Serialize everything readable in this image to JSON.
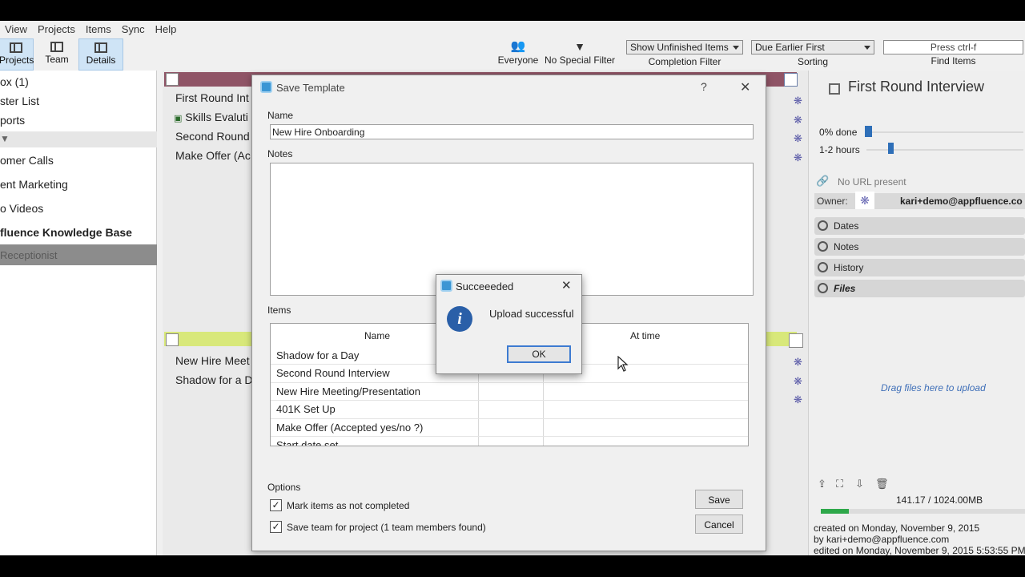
{
  "menu": [
    "View",
    "Projects",
    "Items",
    "Sync",
    "Help"
  ],
  "toolbar": {
    "projects": "Projects",
    "team": "Team",
    "details": "Details",
    "everyone": "Everyone",
    "no_special_filter": "No Special Filter",
    "completion_value": "Show Unfinished Items",
    "completion_label": "Completion Filter",
    "sorting_value": "Due Earlier First",
    "sorting_label": "Sorting",
    "find_placeholder": "Press ctrl-f",
    "find_label": "Find Items"
  },
  "leftnav": {
    "items": [
      "ox (1)",
      "ster List",
      "ports",
      "omer Calls",
      "ent Marketing",
      "o Videos",
      "fluence Knowledge Base",
      "Receptionist"
    ]
  },
  "center": {
    "items_top": [
      "First Round Int",
      "Skills Evaluti",
      "Second Round",
      "Make Offer (Ac"
    ],
    "items_bottom": [
      "New Hire Meet",
      "Shadow for a D"
    ]
  },
  "right": {
    "title": "First Round Interview",
    "done": "0% done",
    "hours": "1-2 hours",
    "progress_pct": 0,
    "url": "No URL present",
    "owner_label": "Owner:",
    "owner_value": "kari+demo@appfluence.co",
    "sections": [
      "Dates",
      "Notes",
      "History",
      "Files"
    ],
    "drag_hint": "Drag files here to upload",
    "storage": "141.17 / 1024.00MB",
    "storage_fraction": 0.138,
    "created": "created on Monday, November 9, 2015",
    "by": "by kari+demo@appfluence.com",
    "edited": "edited on Monday, November 9, 2015 5:53:55 PM"
  },
  "save_dialog": {
    "title": "Save Template",
    "help": "?",
    "close": "✕",
    "name_label": "Name",
    "name_value": "New Hire Onboarding",
    "notes_label": "Notes",
    "items_label": "Items",
    "col_name": "Name",
    "col_time": "At time",
    "rows": [
      "Shadow for a Day",
      "Second Round Interview",
      "New Hire Meeting/Presentation",
      "401K Set Up",
      "Make Offer (Accepted yes/no ?)",
      "Start date set"
    ],
    "options_label": "Options",
    "opt1": "Mark items as not completed",
    "opt2": "Save team for project (1 team members found)",
    "save": "Save",
    "cancel": "Cancel"
  },
  "success": {
    "title": "Succeeeded",
    "close": "✕",
    "message": "Upload successful",
    "ok": "OK"
  },
  "colors": {
    "accent": "#3b96d4",
    "project_bar_top": "#8f5466",
    "project_bar_bottom": "#d8e87a",
    "storage_fill": "#2ea84a"
  }
}
